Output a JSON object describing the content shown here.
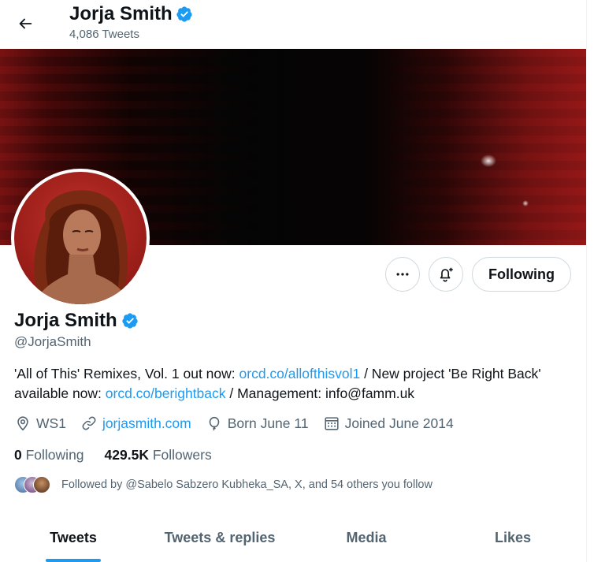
{
  "header": {
    "name": "Jorja Smith",
    "tweet_count": "4,086 Tweets"
  },
  "profile": {
    "display_name": "Jorja Smith",
    "handle": "@JorjaSmith",
    "bio": {
      "part1": "'All of This' Remixes, Vol. 1 out now: ",
      "link1": "orcd.co/allofthisvol1",
      "part2": " / New project 'Be Right Back' available now: ",
      "link2": "orcd.co/berightback",
      "part3": " / Management: info@famm.uk"
    },
    "location": "WS1",
    "website": "jorjasmith.com",
    "birthday": "Born June 11",
    "joined": "Joined June 2014",
    "following_count": "0",
    "following_label": "Following",
    "followers_count": "429.5K",
    "followers_label": "Followers",
    "followed_by": "Followed by @Sabelo Sabzero Kubheka_SA, X, and 54 others you follow"
  },
  "actions": {
    "following_button": "Following"
  },
  "tabs": [
    {
      "label": "Tweets",
      "active": true
    },
    {
      "label": "Tweets & replies",
      "active": false
    },
    {
      "label": "Media",
      "active": false
    },
    {
      "label": "Likes",
      "active": false
    }
  ],
  "colors": {
    "accent": "#1d9bf0",
    "text_primary": "#0f1419",
    "text_secondary": "#536471",
    "border": "#cfd9de"
  },
  "icons": {
    "back": "arrow-left-icon",
    "verified": "verified-badge-icon",
    "more": "ellipsis-icon",
    "notify": "bell-plus-icon",
    "location": "location-pin-icon",
    "link": "link-icon",
    "birthday": "balloon-icon",
    "calendar": "calendar-icon"
  }
}
